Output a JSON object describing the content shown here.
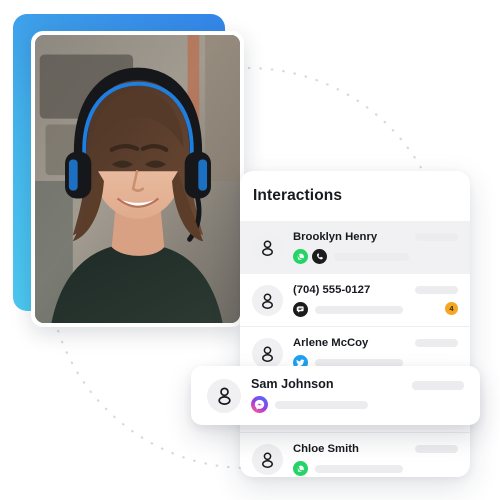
{
  "panel": {
    "title": "Interactions",
    "rows": [
      {
        "name": "Brooklyn Henry",
        "channels": [
          "whatsapp-icon",
          "phone-icon"
        ],
        "badge": "",
        "active": true
      },
      {
        "name": "(704) 555-0127",
        "channels": [
          "sms-chat-icon"
        ],
        "badge": "4",
        "active": false
      },
      {
        "name": "Arlene McCoy",
        "channels": [
          "twitter-icon"
        ],
        "badge": "",
        "active": false
      },
      {
        "name": "Chloe Smith",
        "channels": [
          "whatsapp-icon"
        ],
        "badge": "",
        "active": false
      }
    ]
  },
  "floating_row": {
    "name": "Sam Johnson",
    "channels": [
      "messenger-icon"
    ],
    "badge": ""
  },
  "media": {
    "photo_alt": "smiling-woman-wearing-headphones",
    "avatar_icon": "person-icon"
  },
  "colors": {
    "gradient_start": "#4cc8f0",
    "gradient_end": "#3385e8",
    "whatsapp": "#25d366",
    "twitter": "#1da1f2",
    "phone_dark": "#1c1c1c",
    "sms_dark": "#1c1c1c",
    "messenger_start": "#9b33e8",
    "messenger_end": "#ff4f7e",
    "badge": "#f5a623",
    "row_active": "#f1f1f3",
    "placeholder_bar": "#ececee"
  }
}
